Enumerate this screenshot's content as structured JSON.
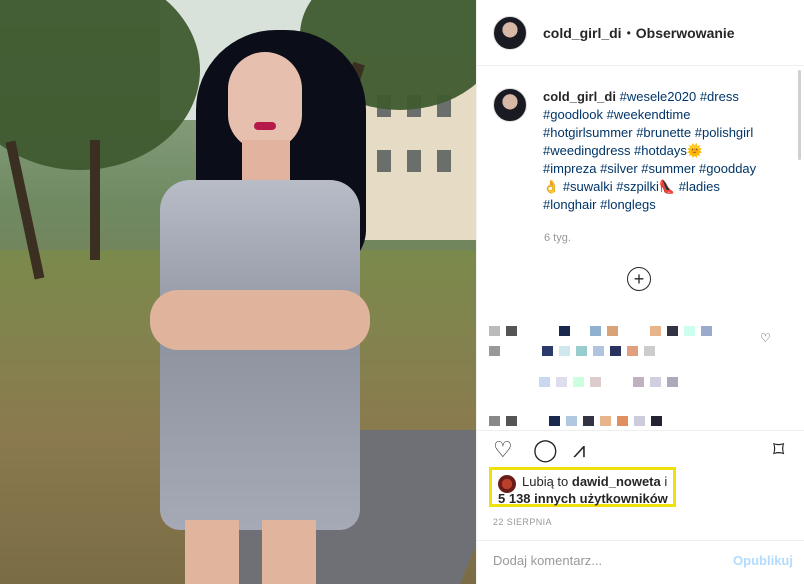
{
  "header": {
    "username": "cold_girl_di",
    "separator": "•",
    "follow_label": "Obserwowanie"
  },
  "caption": {
    "username": "cold_girl_di",
    "tags_line1": "#wesele2020 #dress",
    "tags_line2": "#goodlook #weekendtime",
    "tags_line3": "#hotgirlsummer #brunette #polishgirl",
    "tags_line4": "#weedingdress #hotdays🌞",
    "tags_line5": "#impreza #silver #summer #goodday",
    "tags_line6_emoji": "👌",
    "tags_line6": "#suwalki #szpilki👠 #ladies",
    "tags_line7": "#longhair #longlegs",
    "age": "6 tyg."
  },
  "load_more_icon": "plus-circle-icon",
  "likes": {
    "prefix": "Lubią to",
    "user": "dawid_noweta",
    "suffix": "i",
    "others": "5 138 innych użytkowników"
  },
  "date": "22 SIERPNIA",
  "comment": {
    "placeholder": "Dodaj komentarz...",
    "publish_label": "Opublikuj"
  },
  "colors": {
    "highlight": "#f0e10c",
    "link": "#003569",
    "publish_disabled": "#b3dbff"
  }
}
